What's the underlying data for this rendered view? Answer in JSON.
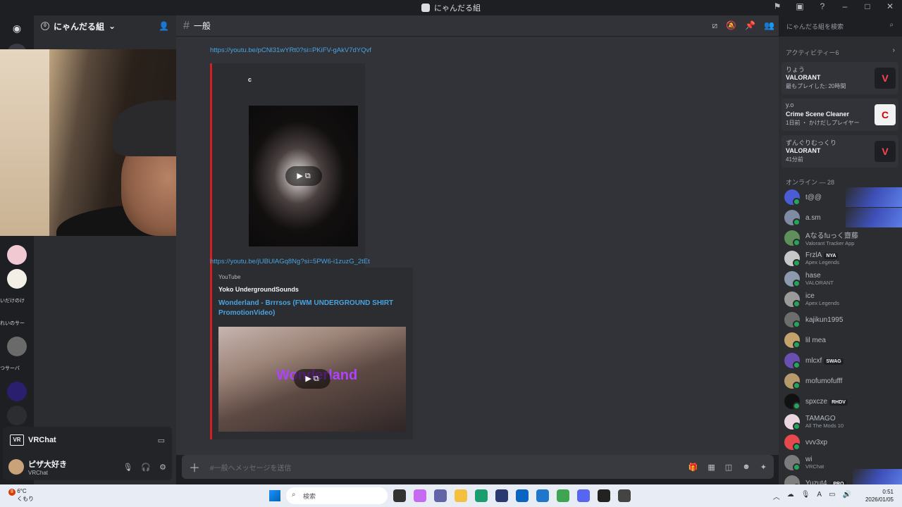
{
  "window": {
    "title": "にゃんだる組"
  },
  "server": {
    "name": "にゃんだる組",
    "boost_count": "0"
  },
  "server_rail": {
    "labels": [
      "いだけのけ",
      "れいのサー",
      "つサーバ"
    ]
  },
  "channel": {
    "name": "一般"
  },
  "search": {
    "placeholder": "にゃんだる組を検索"
  },
  "messages": {
    "link1": "https://youtu.be/pCNl31wYRt0?si=PKiFV-gAkV7dYQvf",
    "embed1_letter": "c",
    "link2": "https://youtu.be/jUBUlAGq8Ng?si=5PW6-i1zuzG_2tEt",
    "embed2": {
      "provider": "YouTube",
      "author": "Yoko UndergroundSounds",
      "title": "Wonderland - Brrrsos (FWM UNDERGROUND SHIRT PromotionVideo)",
      "thumb_text": "Wonderland"
    }
  },
  "composer": {
    "placeholder": "#一般へメッセージを送信"
  },
  "voice": {
    "app": "VRChat",
    "logo": "VR"
  },
  "user": {
    "name": "ピザ大好き",
    "status": "VRChat"
  },
  "activity": {
    "header": "アクティビティー6",
    "cards": [
      {
        "user": "りょう",
        "game": "VALORANT",
        "detail": "最もプレイした: 20時間",
        "icon": "V"
      },
      {
        "user": "y.o",
        "game": "Crime Scene Cleaner",
        "detail": "1日前 ・ かけだしプレイヤー",
        "icon": "C"
      },
      {
        "user": "ずんぐりむっくり",
        "game": "VALORANT",
        "detail": "41分前",
        "icon": "V"
      }
    ]
  },
  "online": {
    "header": "オンライン — 28",
    "members": [
      {
        "name": "t@@",
        "activity": "",
        "tag": "",
        "color": "#4a5cd6"
      },
      {
        "name": "a.sm",
        "activity": "",
        "tag": "",
        "color": "#7f8ba3"
      },
      {
        "name": "Aなるfuっく齋藤",
        "activity": "Valorant Tracker App",
        "tag": "",
        "color": "#5f8f5a"
      },
      {
        "name": "FrzlA",
        "activity": "Apex Legends",
        "tag": "NYA",
        "color": "#c7c7c7"
      },
      {
        "name": "hase",
        "activity": "VALORANT",
        "tag": "",
        "color": "#8d9aad"
      },
      {
        "name": "ice",
        "activity": "Apex Legends",
        "tag": "",
        "color": "#9a9a9a"
      },
      {
        "name": "kajikun1995",
        "activity": "",
        "tag": "",
        "color": "#6d6d6d"
      },
      {
        "name": "lil mea",
        "activity": "",
        "tag": "",
        "color": "#c2a36b"
      },
      {
        "name": "mlcxf",
        "activity": "",
        "tag": "SWAG",
        "color": "#6a4fb0"
      },
      {
        "name": "mofumofufff",
        "activity": "",
        "tag": "",
        "color": "#b69a6b"
      },
      {
        "name": "spxcze",
        "activity": "",
        "tag": "RHDV",
        "color": "#111111"
      },
      {
        "name": "TAMAGO",
        "activity": "All The Mods 10",
        "tag": "",
        "color": "#e9d6de"
      },
      {
        "name": "vvv3xp",
        "activity": "",
        "tag": "",
        "color": "#e5484d"
      },
      {
        "name": "wi",
        "activity": "VRChat",
        "tag": "",
        "color": "#7b7b7b"
      },
      {
        "name": "Yuzut4.",
        "activity": "",
        "tag": "PRO",
        "color": "#7d7d7d"
      }
    ]
  },
  "taskbar": {
    "weather_temp": "6°C",
    "weather_desc": "くもり",
    "weather_badge": "8",
    "search_label": "検索",
    "time": "0:51",
    "date": "2026/01/05"
  }
}
